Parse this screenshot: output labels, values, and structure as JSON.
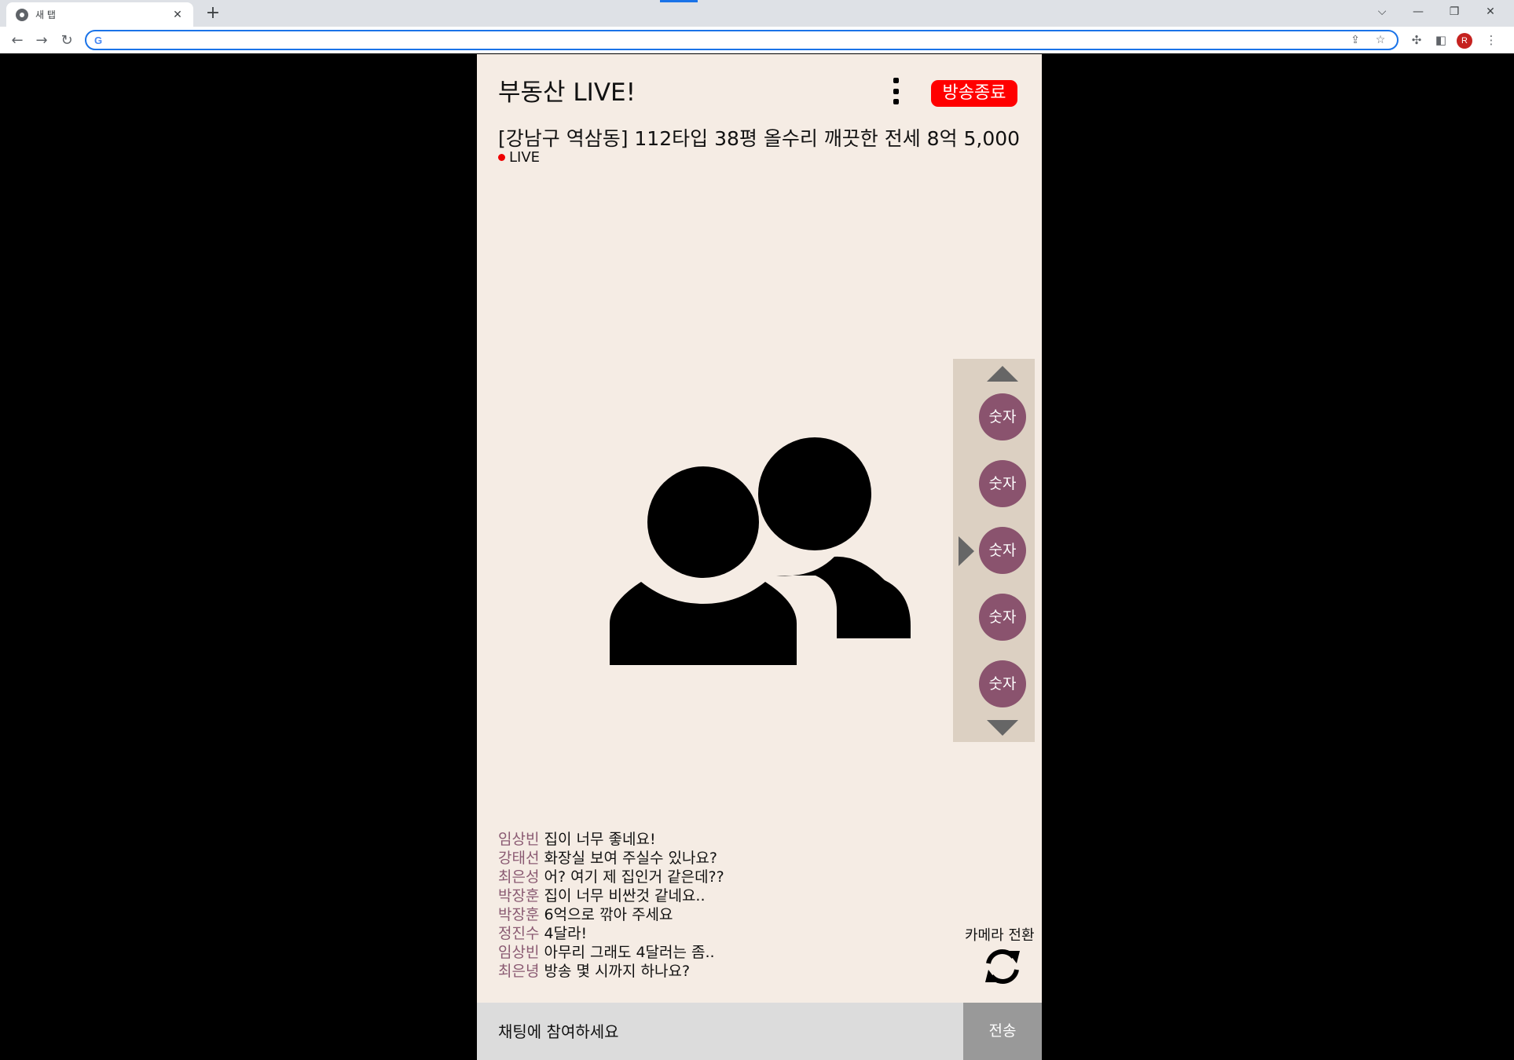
{
  "browser": {
    "tab_title": "새 탭",
    "tab_close": "✕",
    "new_tab": "+",
    "window_buttons": {
      "tab_search": "⌵",
      "minimize": "—",
      "restore": "❐",
      "close": "✕"
    },
    "omnibox": {
      "value": "",
      "placeholder": ""
    },
    "profile_initial": "R",
    "nav": {
      "back": "←",
      "forward": "→",
      "reload": "↻"
    }
  },
  "app": {
    "title": "부동산 LIVE!",
    "end_broadcast_label": "방송종료",
    "listing_title": "[강남구 역삼동] 112타입 38평 올수리 깨끗한 전세 8억 5,000",
    "live_label": "LIVE",
    "number_buttons": [
      "숫자",
      "숫자",
      "숫자",
      "숫자",
      "숫자"
    ],
    "chat": [
      {
        "user": "임상빈",
        "message": "집이 너무 좋네요!"
      },
      {
        "user": "강태선",
        "message": "화장실 보여 주실수 있나요?"
      },
      {
        "user": "최은성",
        "message": "어? 여기 제 집인거 같은데??"
      },
      {
        "user": "박장훈",
        "message": "집이 너무 비싼것 같네요.."
      },
      {
        "user": "박장훈",
        "message": "6억으로 깎아 주세요"
      },
      {
        "user": "정진수",
        "message": "4달라!"
      },
      {
        "user": "임상빈",
        "message": "아무리 그래도 4달러는 좀.."
      },
      {
        "user": "최은녕",
        "message": "방송 몇 시까지 하나요?"
      }
    ],
    "camera_switch_label": "카메라 전환",
    "chat_input_placeholder": "채팅에 참여하세요",
    "send_label": "전송",
    "colors": {
      "background": "#f5ece4",
      "end_button": "#ff0000",
      "number_button": "#8a536e",
      "chat_user": "#8a5a72",
      "side_panel": "#dcd0c2"
    }
  }
}
